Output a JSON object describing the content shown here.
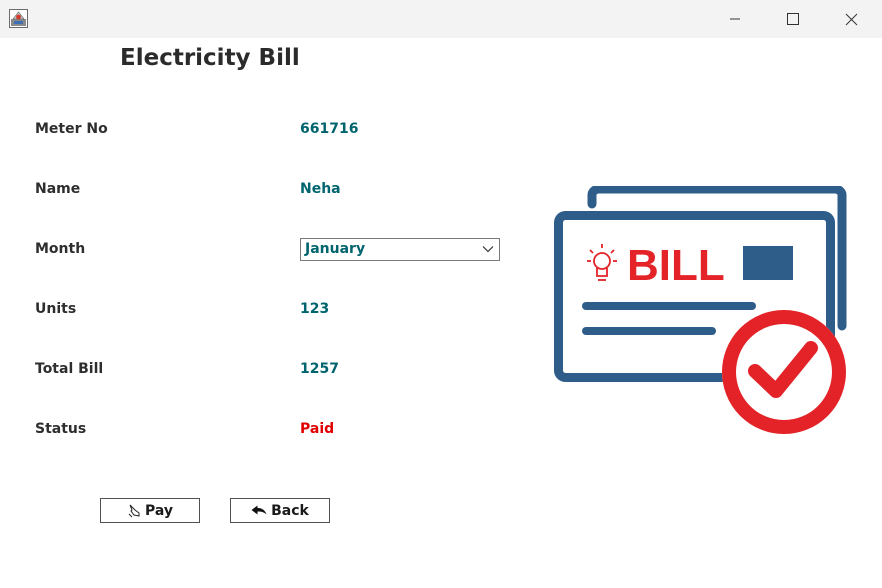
{
  "window": {
    "title": "",
    "controls": [
      "minimize",
      "maximize",
      "close"
    ]
  },
  "page": {
    "title": "Electricity Bill"
  },
  "fields": {
    "meter_no": {
      "label": "Meter No",
      "value": "661716"
    },
    "name": {
      "label": "Name",
      "value": "Neha"
    },
    "month": {
      "label": "Month",
      "selected": "January"
    },
    "units": {
      "label": "Units",
      "value": "123"
    },
    "total_bill": {
      "label": "Total Bill",
      "value": "1257"
    },
    "status": {
      "label": "Status",
      "value": "Paid"
    }
  },
  "buttons": {
    "pay": {
      "label": "Pay",
      "icon": "hand-pointer-icon"
    },
    "back": {
      "label": "Back",
      "icon": "back-arrow-icon"
    }
  },
  "illustration": {
    "text": "BILL",
    "colors": {
      "blue": "#2f5d8a",
      "red": "#e32328"
    }
  },
  "colors": {
    "value_text": "#00646e",
    "status_paid": "#e00000",
    "label_text": "#2e2e2e"
  }
}
